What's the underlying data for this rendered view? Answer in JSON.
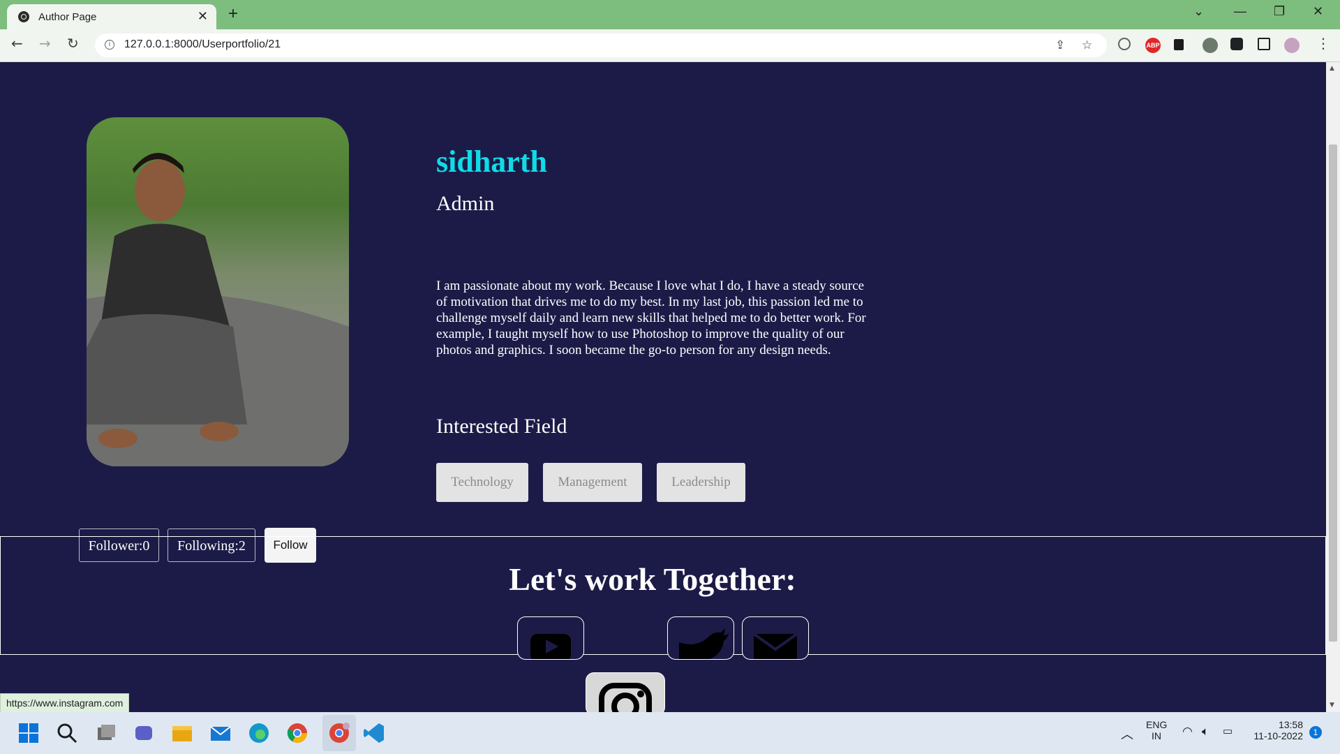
{
  "browser": {
    "tab_title": "Author Page",
    "url": "127.0.0.1:8000/Userportfolio/21",
    "status_url": "https://www.instagram.com"
  },
  "profile": {
    "name": "sidharth",
    "role": "Admin",
    "bio": "I am passionate about my work. Because I love what I do, I have a steady source of motivation that drives me to do my best. In my last job, this passion led me to challenge myself daily and learn new skills that helped me to do better work. For example, I taught myself how to use Photoshop to improve the quality of our photos and graphics. I soon became the go-to person for any design needs.",
    "interested_title": "Interested Field",
    "fields": [
      "Technology",
      "Management",
      "Leadership"
    ],
    "follower_label": "Follower:0",
    "following_label": "Following:2",
    "follow_button": "Follow"
  },
  "footer": {
    "title": "Let's work Together:",
    "socials": [
      "youtube-icon",
      "instagram-icon",
      "twitter-icon",
      "mail-icon"
    ]
  },
  "taskbar": {
    "language_line1": "ENG",
    "language_line2": "IN",
    "time": "13:58",
    "date": "11-10-2022",
    "notification_count": "1"
  },
  "colors": {
    "page_bg": "#1c1b47",
    "name_accent": "#10dbe6",
    "tabbar": "#7dbd7d"
  }
}
